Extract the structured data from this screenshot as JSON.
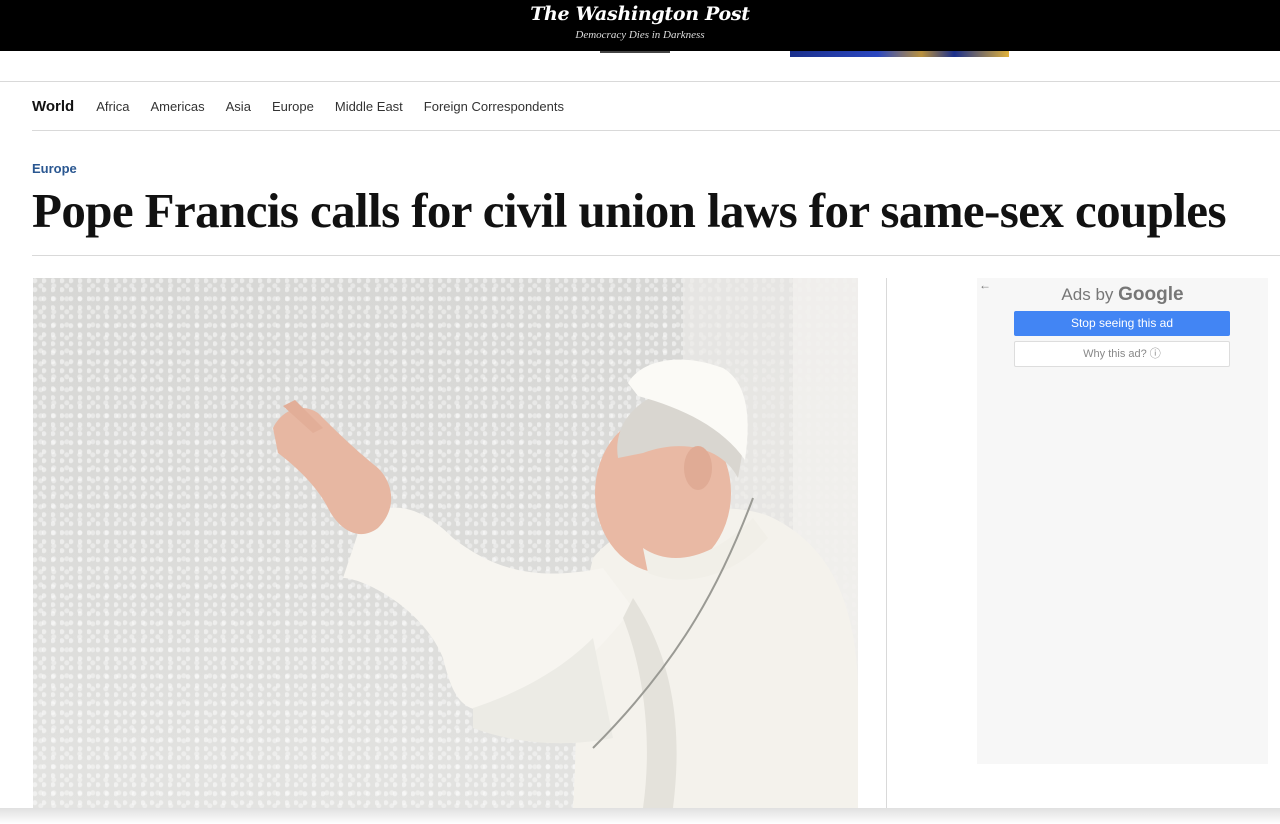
{
  "masthead": {
    "logo": "The Washington Post",
    "tagline": "Democracy Dies in Darkness"
  },
  "section_nav": {
    "main": "World",
    "items": [
      "Africa",
      "Americas",
      "Asia",
      "Europe",
      "Middle East",
      "Foreign Correspondents"
    ]
  },
  "article": {
    "kicker": "Europe",
    "headline": "Pope Francis calls for civil union laws for same-sex couples"
  },
  "ad": {
    "back_icon": "←",
    "ads_by_prefix": "Ads by ",
    "ads_by_brand": "Google",
    "stop_label": "Stop seeing this ad",
    "why_label": "Why this ad? ⓘ"
  },
  "colors": {
    "masthead_bg": "#000000",
    "kicker": "#2a5791",
    "ad_button": "#4285f4"
  }
}
